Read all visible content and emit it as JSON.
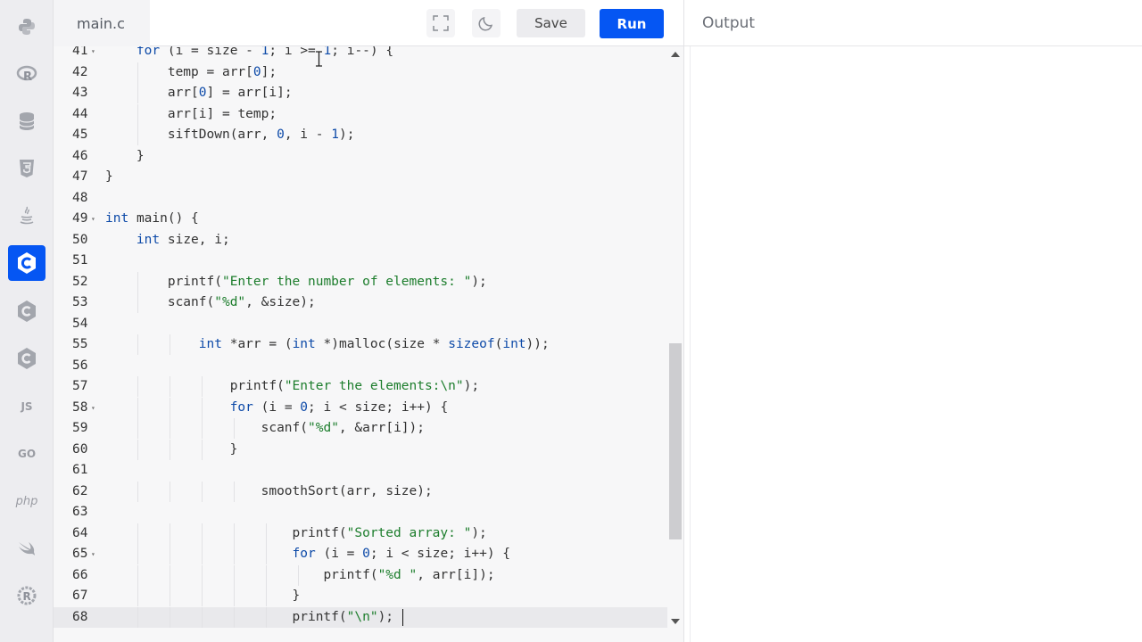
{
  "header": {
    "file_tab": "main.c",
    "save_label": "Save",
    "run_label": "Run"
  },
  "sidebar": {
    "items": [
      {
        "name": "python-icon",
        "active": false
      },
      {
        "name": "r-icon",
        "active": false
      },
      {
        "name": "database-icon",
        "active": false
      },
      {
        "name": "html5-icon",
        "active": false
      },
      {
        "name": "java-icon",
        "active": false
      },
      {
        "name": "c-icon",
        "active": true
      },
      {
        "name": "cpp-icon",
        "active": false
      },
      {
        "name": "csharp-icon",
        "active": false
      },
      {
        "name": "js-icon",
        "label": "JS",
        "active": false
      },
      {
        "name": "go-icon",
        "label": "GO",
        "active": false
      },
      {
        "name": "php-icon",
        "label": "php",
        "active": false
      },
      {
        "name": "swift-icon",
        "active": false
      },
      {
        "name": "rust-icon",
        "active": false
      }
    ]
  },
  "editor": {
    "lines": [
      {
        "n": "41",
        "text": "    for (i = size - 1; i >= 1; i--) {"
      },
      {
        "n": "42",
        "text": "        temp = arr[0];"
      },
      {
        "n": "43",
        "text": "        arr[0] = arr[i];"
      },
      {
        "n": "44",
        "text": "        arr[i] = temp;"
      },
      {
        "n": "45",
        "text": "        siftDown(arr, 0, i - 1);"
      },
      {
        "n": "46",
        "text": "    }"
      },
      {
        "n": "47",
        "text": "}"
      },
      {
        "n": "48",
        "text": ""
      },
      {
        "n": "49",
        "text": "int main() {"
      },
      {
        "n": "50",
        "text": "    int size, i;"
      },
      {
        "n": "51",
        "text": ""
      },
      {
        "n": "52",
        "text": "        printf(\"Enter the number of elements: \");"
      },
      {
        "n": "53",
        "text": "        scanf(\"%d\", &size);"
      },
      {
        "n": "54",
        "text": ""
      },
      {
        "n": "55",
        "text": "            int *arr = (int *)malloc(size * sizeof(int));"
      },
      {
        "n": "56",
        "text": ""
      },
      {
        "n": "57",
        "text": "                printf(\"Enter the elements:\\n\");"
      },
      {
        "n": "58",
        "text": "                for (i = 0; i < size; i++) {"
      },
      {
        "n": "59",
        "text": "                    scanf(\"%d\", &arr[i]);"
      },
      {
        "n": "60",
        "text": "                }"
      },
      {
        "n": "61",
        "text": ""
      },
      {
        "n": "62",
        "text": "                    smoothSort(arr, size);"
      },
      {
        "n": "63",
        "text": ""
      },
      {
        "n": "64",
        "text": "                        printf(\"Sorted array: \");"
      },
      {
        "n": "65",
        "text": "                        for (i = 0; i < size; i++) {"
      },
      {
        "n": "66",
        "text": "                            printf(\"%d \", arr[i]);"
      },
      {
        "n": "67",
        "text": "                        }"
      },
      {
        "n": "68",
        "text": "                        printf(\"\\n\");"
      }
    ],
    "fold_lines": [
      "41",
      "49",
      "58",
      "65"
    ],
    "current_line": "68"
  },
  "output": {
    "title": "Output"
  }
}
